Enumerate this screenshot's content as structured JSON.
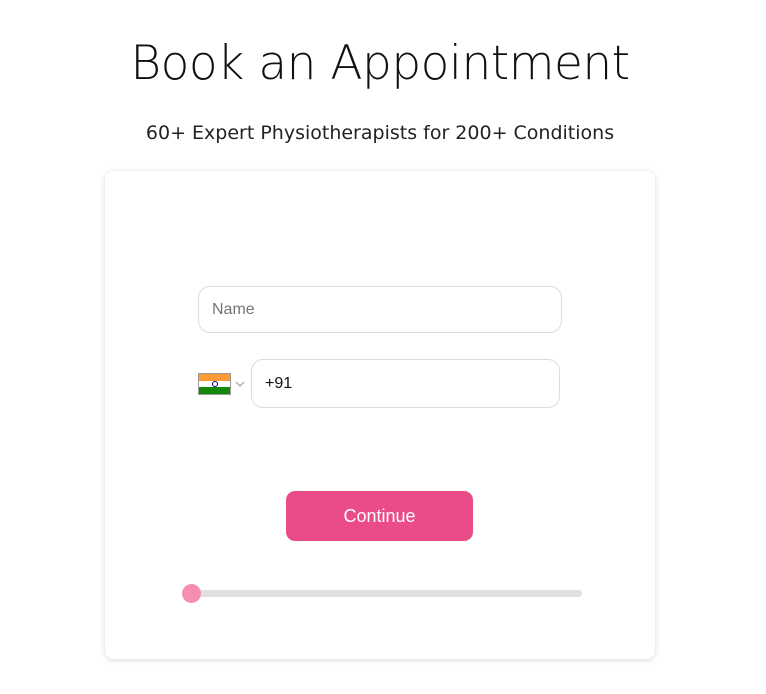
{
  "header": {
    "title": "Book an Appointment",
    "subtitle": "60+ Expert Physiotherapists for 200+ Conditions"
  },
  "form": {
    "name_placeholder": "Name",
    "name_value": "",
    "country": {
      "selected": "India",
      "flag_icon": "india-flag-icon",
      "chevron_icon": "chevron-down-icon"
    },
    "phone_value": "+91",
    "continue_label": "Continue",
    "progress": 0
  },
  "colors": {
    "accent": "#ea4c89",
    "slider_thumb": "#f48fb1",
    "slider_track": "#e0e0e0",
    "flag_saffron": "#ff9933",
    "flag_green": "#138808",
    "flag_chakra": "#000080"
  }
}
